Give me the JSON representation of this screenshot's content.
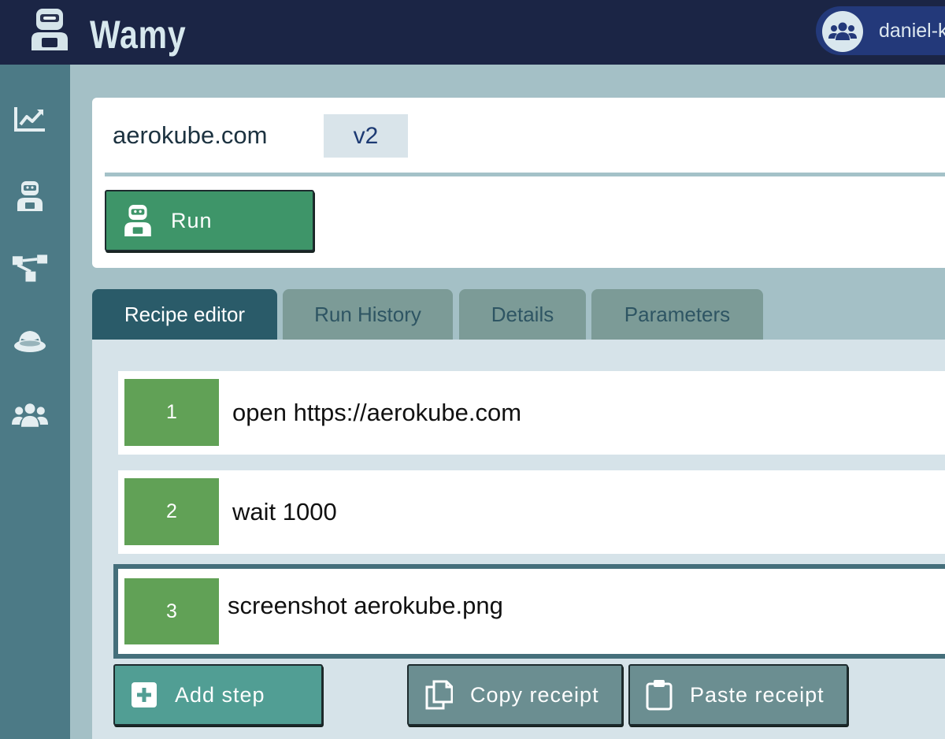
{
  "header": {
    "app_title": "Wamy",
    "user_name": "daniel-k",
    "icons": {
      "logo": "robot-logo-icon",
      "user": "users-icon"
    }
  },
  "sidebar": {
    "items": [
      {
        "icon": "chart-line-icon"
      },
      {
        "icon": "robot-icon"
      },
      {
        "icon": "sitemap-icon"
      },
      {
        "icon": "hat-icon"
      },
      {
        "icon": "users-icon"
      }
    ]
  },
  "recipe": {
    "name": "aerokube.com",
    "version": "v2",
    "run_label": "Run"
  },
  "tabs": [
    {
      "label": "Recipe editor",
      "active": true
    },
    {
      "label": "Run History",
      "active": false
    },
    {
      "label": "Details",
      "active": false
    },
    {
      "label": "Parameters",
      "active": false
    }
  ],
  "steps": [
    {
      "number": "1",
      "command": "open https://aerokube.com"
    },
    {
      "number": "2",
      "command": "wait 1000"
    },
    {
      "number": "3",
      "command": "screenshot aerokube.png",
      "selected": true
    }
  ],
  "actions": {
    "add_step": "Add step",
    "copy_receipt": "Copy receipt",
    "paste_receipt": "Paste receipt"
  },
  "colors": {
    "header_bg": "#1b2545",
    "sidebar_bg": "#4c7a86",
    "run_button": "#3e9569",
    "step_number": "#61a156",
    "active_tab": "#2a5b69"
  }
}
